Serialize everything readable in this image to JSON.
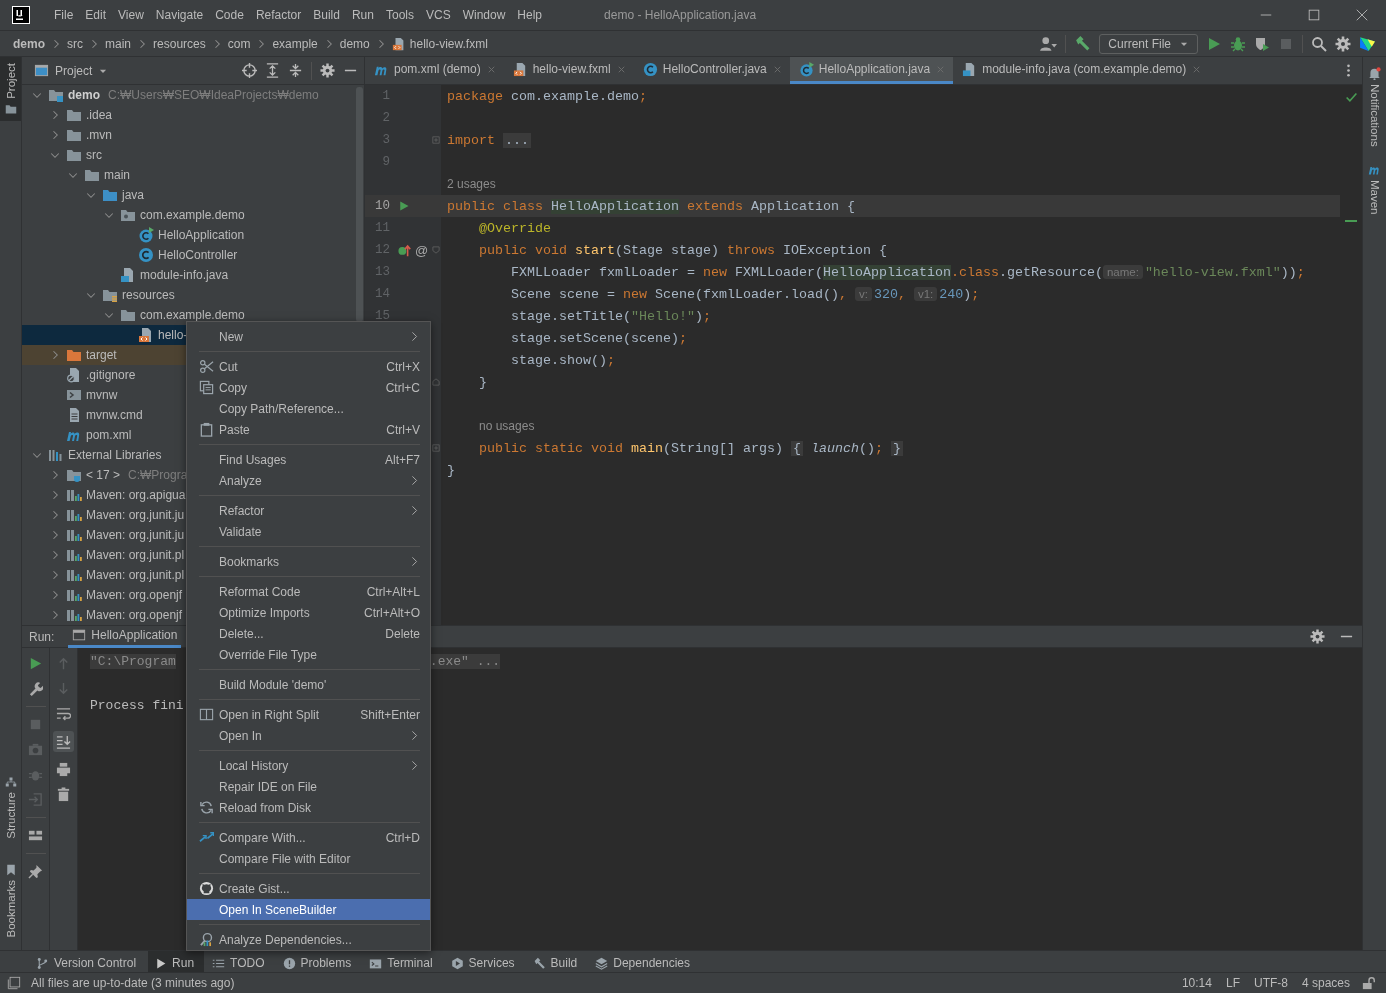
{
  "window": {
    "title": "demo - HelloApplication.java"
  },
  "menu_bar": [
    "File",
    "Edit",
    "View",
    "Navigate",
    "Code",
    "Refactor",
    "Build",
    "Run",
    "Tools",
    "VCS",
    "Window",
    "Help"
  ],
  "breadcrumbs": [
    {
      "label": "demo",
      "kind": "module"
    },
    {
      "label": "src",
      "kind": "folder"
    },
    {
      "label": "main",
      "kind": "folder"
    },
    {
      "label": "resources",
      "kind": "folder"
    },
    {
      "label": "com",
      "kind": "folder"
    },
    {
      "label": "example",
      "kind": "folder"
    },
    {
      "label": "demo",
      "kind": "folder"
    },
    {
      "label": "hello-view.fxml",
      "kind": "fxml"
    }
  ],
  "run_config": {
    "label": "Current File"
  },
  "left_stripe": [
    {
      "label": "Project",
      "kind": "folder",
      "selected": true
    },
    {
      "label": "Structure",
      "kind": "structure",
      "selected": false
    },
    {
      "label": "Bookmarks",
      "kind": "bookmark",
      "selected": false
    }
  ],
  "right_stripe": [
    {
      "label": "Notifications",
      "kind": "bell"
    },
    {
      "label": "Maven",
      "kind": "maven"
    }
  ],
  "project": {
    "title": "Project",
    "tree": [
      {
        "label": "demo",
        "detail": "C:₩Users₩SEO₩IdeaProjects₩demo",
        "kind": "module",
        "expanded": true,
        "selected": false,
        "children": [
          {
            "label": ".idea",
            "kind": "folder",
            "expanded": false,
            "selected": false
          },
          {
            "label": ".mvn",
            "kind": "folder",
            "expanded": false,
            "selected": false
          },
          {
            "label": "src",
            "kind": "folder",
            "expanded": true,
            "selected": false,
            "children": [
              {
                "label": "main",
                "kind": "folder",
                "expanded": true,
                "selected": false,
                "children": [
                  {
                    "label": "java",
                    "kind": "srcfolder",
                    "expanded": true,
                    "selected": false,
                    "children": [
                      {
                        "label": "com.example.demo",
                        "kind": "package",
                        "expanded": true,
                        "selected": false,
                        "children": [
                          {
                            "label": "HelloApplication",
                            "kind": "classmain",
                            "selected": false
                          },
                          {
                            "label": "HelloController",
                            "kind": "class",
                            "selected": false
                          }
                        ]
                      },
                      {
                        "label": "module-info.java",
                        "kind": "moduleinfo",
                        "selected": false
                      }
                    ]
                  },
                  {
                    "label": "resources",
                    "kind": "resfolder",
                    "expanded": true,
                    "selected": false,
                    "children": [
                      {
                        "label": "com.example.demo",
                        "kind": "folder",
                        "expanded": true,
                        "selected": false,
                        "children": [
                          {
                            "label": "hello-",
                            "kind": "fxml",
                            "selected": true
                          }
                        ]
                      }
                    ]
                  }
                ]
              }
            ]
          },
          {
            "label": "target",
            "kind": "excluded",
            "expanded": false,
            "selected": false
          },
          {
            "label": ".gitignore",
            "kind": "gitignore",
            "selected": false
          },
          {
            "label": "mvnw",
            "kind": "script",
            "selected": false
          },
          {
            "label": "mvnw.cmd",
            "kind": "textfile",
            "selected": false
          },
          {
            "label": "pom.xml",
            "kind": "maven",
            "selected": false
          }
        ]
      },
      {
        "label": "External Libraries",
        "kind": "libraries",
        "expanded": true,
        "selected": false,
        "children": [
          {
            "label": "< 17 >",
            "detail": "C:₩Progra",
            "kind": "jdk",
            "expanded": false,
            "selected": false
          },
          {
            "label": "Maven: org.apigua",
            "kind": "library",
            "expanded": false,
            "selected": false
          },
          {
            "label": "Maven: org.junit.ju",
            "kind": "library",
            "expanded": false,
            "selected": false
          },
          {
            "label": "Maven: org.junit.ju",
            "kind": "library",
            "expanded": false,
            "selected": false
          },
          {
            "label": "Maven: org.junit.pl",
            "kind": "library",
            "expanded": false,
            "selected": false
          },
          {
            "label": "Maven: org.junit.pl",
            "kind": "library",
            "expanded": false,
            "selected": false
          },
          {
            "label": "Maven: org.openjf",
            "kind": "library",
            "expanded": false,
            "selected": false
          },
          {
            "label": "Maven: org.openjf",
            "kind": "library",
            "expanded": false,
            "selected": false
          }
        ]
      }
    ]
  },
  "editor": {
    "tabs": [
      {
        "label": "pom.xml (demo)",
        "kind": "maven",
        "selected": false
      },
      {
        "label": "hello-view.fxml",
        "kind": "fxml",
        "selected": false
      },
      {
        "label": "HelloController.java",
        "kind": "class",
        "selected": false
      },
      {
        "label": "HelloApplication.java",
        "kind": "classmain",
        "selected": true
      },
      {
        "label": "module-info.java (com.example.demo)",
        "kind": "moduleinfo",
        "selected": false
      }
    ],
    "lines": [
      {
        "kind": "code",
        "number": "1",
        "current": false,
        "tokens": [
          {
            "kind": "kw",
            "text": "package"
          },
          {
            "kind": "plain",
            "text": " com.example.demo"
          },
          {
            "kind": "punct",
            "text": ";"
          }
        ]
      },
      {
        "kind": "code",
        "number": "2"
      },
      {
        "kind": "code",
        "number": "3",
        "fold": {
          "kind": "collapsed"
        },
        "current": false,
        "tokens": [
          {
            "kind": "kw",
            "text": "import "
          },
          {
            "kind": "folded",
            "text": "..."
          }
        ]
      },
      {
        "kind": "code",
        "number": "9"
      },
      {
        "kind": "hint",
        "tokens": [
          {
            "kind": "usages",
            "text": "2 usages"
          }
        ]
      },
      {
        "kind": "code",
        "number": "10",
        "current": true,
        "gutter": [
          {
            "kind": "run"
          }
        ],
        "tokens": [
          {
            "kind": "kw",
            "text": "public class "
          },
          {
            "kind": "usage",
            "text": "HelloApplication"
          },
          {
            "kind": "kw",
            "text": " extends"
          },
          {
            "kind": "plain",
            "text": " Application {"
          }
        ]
      },
      {
        "kind": "code",
        "number": "11",
        "current": false,
        "tokens": [
          {
            "kind": "annotation",
            "text": "    @Override"
          }
        ]
      },
      {
        "kind": "code",
        "number": "12",
        "current": false,
        "gutter": [
          {
            "kind": "override"
          }
        ],
        "marker": "@",
        "fold": {
          "kind": "start"
        },
        "tokens": [
          {
            "kind": "kw",
            "text": "    public void "
          },
          {
            "kind": "method",
            "text": "start"
          },
          {
            "kind": "plain",
            "text": "(Stage stage) "
          },
          {
            "kind": "kw",
            "text": "throws"
          },
          {
            "kind": "plain",
            "text": " IOException {"
          }
        ]
      },
      {
        "kind": "code",
        "number": "13",
        "current": false,
        "tokens": [
          {
            "kind": "plain",
            "text": "        FXMLLoader fxmlLoader = "
          },
          {
            "kind": "kw",
            "text": "new"
          },
          {
            "kind": "plain",
            "text": " FXMLLoader("
          },
          {
            "kind": "usage",
            "text": "HelloApplication"
          },
          {
            "kind": "kw",
            "text": ".class"
          },
          {
            "kind": "plain",
            "text": ".getResource("
          },
          {
            "kind": "inlay",
            "text": "name:"
          },
          {
            "kind": "string",
            "text": "\"hello-view.fxml\""
          },
          {
            "kind": "plain",
            "text": "))"
          },
          {
            "kind": "punct",
            "text": ";"
          }
        ]
      },
      {
        "kind": "code",
        "number": "14",
        "current": false,
        "tokens": [
          {
            "kind": "plain",
            "text": "        Scene scene = "
          },
          {
            "kind": "kw",
            "text": "new"
          },
          {
            "kind": "plain",
            "text": " Scene(fxmlLoader.load()"
          },
          {
            "kind": "punct",
            "text": ", "
          },
          {
            "kind": "inlay",
            "text": "v:"
          },
          {
            "kind": "number",
            "text": "320"
          },
          {
            "kind": "punct",
            "text": ", "
          },
          {
            "kind": "inlay",
            "text": "v1:"
          },
          {
            "kind": "number",
            "text": "240"
          },
          {
            "kind": "plain",
            "text": ")"
          },
          {
            "kind": "punct",
            "text": ";"
          }
        ]
      },
      {
        "kind": "code",
        "number": "15",
        "current": false,
        "tokens": [
          {
            "kind": "plain",
            "text": "        stage.setTitle("
          },
          {
            "kind": "string",
            "text": "\"Hello!\""
          },
          {
            "kind": "plain",
            "text": ")"
          },
          {
            "kind": "punct",
            "text": ";"
          }
        ]
      },
      {
        "kind": "code",
        "current": false,
        "tokens": [
          {
            "kind": "plain",
            "text": "        stage.setScene(scene)"
          },
          {
            "kind": "punct",
            "text": ";"
          }
        ]
      },
      {
        "kind": "code",
        "current": false,
        "tokens": [
          {
            "kind": "plain",
            "text": "        stage.show()"
          },
          {
            "kind": "punct",
            "text": ";"
          }
        ]
      },
      {
        "kind": "code",
        "current": false,
        "fold": {
          "kind": "end"
        },
        "tokens": [
          {
            "kind": "plain",
            "text": "    }"
          }
        ]
      },
      {
        "kind": "code"
      },
      {
        "kind": "hint",
        "tokens": [
          {
            "kind": "usages",
            "text": "no usages"
          }
        ]
      },
      {
        "kind": "code",
        "current": false,
        "fold": {
          "kind": "collapsed"
        },
        "tokens": [
          {
            "kind": "kw",
            "text": "    public static void "
          },
          {
            "kind": "method",
            "text": "main"
          },
          {
            "kind": "plain",
            "text": "(String[] args) "
          },
          {
            "kind": "folded",
            "text": "{"
          },
          {
            "kind": "static",
            "text": " launch"
          },
          {
            "kind": "plain",
            "text": "()"
          },
          {
            "kind": "punct",
            "text": "; "
          },
          {
            "kind": "folded",
            "text": "}"
          }
        ]
      },
      {
        "kind": "code",
        "current": false,
        "tokens": [
          {
            "kind": "plain",
            "text": "}"
          }
        ]
      }
    ]
  },
  "run": {
    "label": "Run:",
    "tabs": [
      {
        "label": "HelloApplication",
        "selected": true
      }
    ],
    "console": [
      {
        "kind": "command",
        "parts": [
          "\"C:\\Program",
          ".exe\" ..."
        ]
      },
      {
        "kind": "output",
        "parts": [
          "Process fini"
        ]
      }
    ]
  },
  "context_menu": [
    {
      "kind": "plain",
      "label": "New",
      "submenu": true,
      "selected": false
    },
    {
      "kind": "separator"
    },
    {
      "kind": "cut",
      "label": "Cut",
      "shortcut": "Ctrl+X",
      "selected": false
    },
    {
      "kind": "copy",
      "label": "Copy",
      "shortcut": "Ctrl+C",
      "selected": false
    },
    {
      "kind": "plain",
      "label": "Copy Path/Reference...",
      "selected": false
    },
    {
      "kind": "paste",
      "label": "Paste",
      "shortcut": "Ctrl+V",
      "selected": false
    },
    {
      "kind": "separator"
    },
    {
      "kind": "plain",
      "label": "Find Usages",
      "shortcut": "Alt+F7",
      "selected": false
    },
    {
      "kind": "plain",
      "label": "Analyze",
      "submenu": true,
      "selected": false
    },
    {
      "kind": "separator"
    },
    {
      "kind": "plain",
      "label": "Refactor",
      "submenu": true,
      "selected": false
    },
    {
      "kind": "plain",
      "label": "Validate",
      "selected": false
    },
    {
      "kind": "separator"
    },
    {
      "kind": "plain",
      "label": "Bookmarks",
      "submenu": true,
      "selected": false
    },
    {
      "kind": "separator"
    },
    {
      "kind": "plain",
      "label": "Reformat Code",
      "shortcut": "Ctrl+Alt+L",
      "selected": false
    },
    {
      "kind": "plain",
      "label": "Optimize Imports",
      "shortcut": "Ctrl+Alt+O",
      "selected": false
    },
    {
      "kind": "plain",
      "label": "Delete...",
      "shortcut": "Delete",
      "selected": false
    },
    {
      "kind": "plain",
      "label": "Override File Type",
      "selected": false
    },
    {
      "kind": "separator"
    },
    {
      "kind": "plain",
      "label": "Build Module 'demo'",
      "selected": false
    },
    {
      "kind": "separator"
    },
    {
      "kind": "split",
      "label": "Open in Right Split",
      "shortcut": "Shift+Enter",
      "selected": false
    },
    {
      "kind": "plain",
      "label": "Open In",
      "submenu": true,
      "selected": false
    },
    {
      "kind": "separator"
    },
    {
      "kind": "plain",
      "label": "Local History",
      "submenu": true,
      "selected": false
    },
    {
      "kind": "plain",
      "label": "Repair IDE on File",
      "selected": false
    },
    {
      "kind": "reload",
      "label": "Reload from Disk",
      "selected": false
    },
    {
      "kind": "separator"
    },
    {
      "kind": "compare",
      "label": "Compare With...",
      "shortcut": "Ctrl+D",
      "selected": false
    },
    {
      "kind": "plain",
      "label": "Compare File with Editor",
      "selected": false
    },
    {
      "kind": "separator"
    },
    {
      "kind": "cat",
      "label": "Create Gist...",
      "selected": false
    },
    {
      "kind": "plain",
      "label": "Open In SceneBuilder",
      "selected": true
    },
    {
      "kind": "separator"
    },
    {
      "kind": "deps",
      "label": "Analyze Dependencies...",
      "selected": false
    }
  ],
  "tool_tabs": [
    {
      "label": "Version Control",
      "kind": "branch",
      "selected": false
    },
    {
      "label": "Run",
      "kind": "play",
      "selected": true
    },
    {
      "label": "TODO",
      "kind": "list",
      "selected": false
    },
    {
      "label": "Problems",
      "kind": "info",
      "selected": false
    },
    {
      "label": "Terminal",
      "kind": "terminal",
      "selected": false
    },
    {
      "label": "Services",
      "kind": "services",
      "selected": false
    },
    {
      "label": "Build",
      "kind": "hammer",
      "selected": false
    },
    {
      "label": "Dependencies",
      "kind": "layers",
      "selected": false
    }
  ],
  "status_bar": {
    "message": "All files are up-to-date (3 minutes ago)",
    "items": [
      "10:14",
      "LF",
      "UTF-8",
      "4 spaces"
    ]
  }
}
